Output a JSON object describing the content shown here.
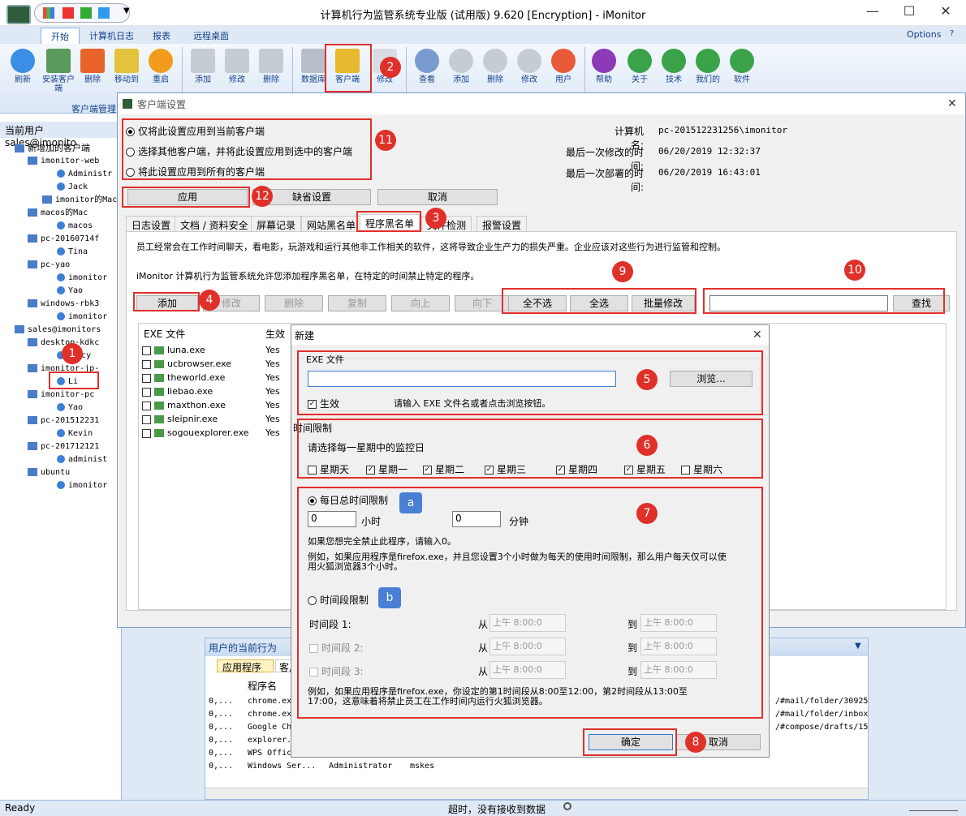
{
  "app": {
    "title": "计算机行为监管系统专业版 (试用版) 9.620 [Encryption] - iMonitor"
  },
  "ribbon": {
    "tabs": [
      "开始",
      "计算机日志",
      "报表",
      "远程桌面"
    ],
    "options": "Options",
    "group_client": "客户端管理",
    "buttons": [
      "刷新",
      "安装客户端",
      "删除",
      "移动到",
      "重启",
      "添加",
      "修改",
      "删除",
      "数据库",
      "客户端",
      "修改",
      "查看",
      "添加",
      "删除",
      "修改",
      "用户",
      "帮助",
      "关于",
      "技术",
      "我们的",
      "软件"
    ]
  },
  "left": {
    "header": "当前用户  sales@imonito",
    "tree": [
      "新增加的客户端",
      "imonitor-web",
      "Administr",
      "Jack",
      "imonitor的Mac",
      "macos的Mac",
      "macos",
      "pc-20160714f",
      "Tina",
      "pc-yao",
      "imonitor",
      "Yao",
      "windows-rbk3",
      "imonitor",
      "sales@imonitors",
      "desktop-kdkc",
      "cy",
      "Nancy",
      "imonitor-jp-",
      "Li",
      "imonitor-pc",
      "Yao",
      "pc-201512231",
      "Kevin",
      "pc-201712121",
      "administ",
      "ubuntu",
      "imonitor"
    ]
  },
  "dialog": {
    "title": "客户端设置",
    "radio1": "仅将此设置应用到当前客户端",
    "radio2": "选择其他客户端，并将此设置应用到选中的客户端",
    "radio3": "将此设置应用到所有的客户端",
    "pc_label": "计算机名:",
    "pc_value": "pc-201512231256\\imonitor",
    "mod_label": "最后一次修改的时间:",
    "mod_value": "06/20/2019 12:32:37",
    "dep_label": "最后一次部署的时间:",
    "dep_value": "06/20/2019 16:43:01",
    "apply": "应用",
    "default": "缺省设置",
    "cancel": "取消",
    "tabs": [
      "日志设置",
      "文档 / 资料安全",
      "屏幕记录",
      "网站黑名单",
      "程序黑名单",
      "文件检测",
      "报警设置"
    ],
    "desc1": "员工经常会在工作时间聊天，看电影，玩游戏和运行其他非工作相关的软件，这将导致企业生产力的损失严重。企业应该对这些行为进行监管和控制。",
    "desc2": "iMonitor 计算机行为监管系统允许您添加程序黑名单，在特定的时间禁止特定的程序。",
    "btns": {
      "add": "添加",
      "modify": "修改",
      "delete": "删除",
      "copy": "复制",
      "up": "向上",
      "down": "向下",
      "unselect": "全不选",
      "selectall": "全选",
      "batch": "批量修改",
      "search": "查找"
    },
    "col_exe": "EXE 文件",
    "col_active": "生效",
    "rows": [
      {
        "exe": "luna.exe",
        "active": "Yes"
      },
      {
        "exe": "ucbrowser.exe",
        "active": "Yes"
      },
      {
        "exe": "theworld.exe",
        "active": "Yes"
      },
      {
        "exe": "liebao.exe",
        "active": "Yes"
      },
      {
        "exe": "maxthon.exe",
        "active": "Yes"
      },
      {
        "exe": "sleipnir.exe",
        "active": "Yes"
      },
      {
        "exe": "sogouexplorer.exe",
        "active": "Yes"
      }
    ]
  },
  "newdlg": {
    "title": "新建",
    "exe_group": "EXE 文件",
    "browse": "浏览...",
    "active": "生效",
    "exe_hint": "请输入 EXE 文件名或者点击浏览按钮。",
    "time_group": "时间限制",
    "days_hint": "请选择每一星期中的监控日",
    "days": [
      {
        "label": "星期天",
        "checked": false
      },
      {
        "label": "星期一",
        "checked": true
      },
      {
        "label": "星期二",
        "checked": true
      },
      {
        "label": "星期三",
        "checked": true
      },
      {
        "label": "星期四",
        "checked": true
      },
      {
        "label": "星期五",
        "checked": true
      },
      {
        "label": "星期六",
        "checked": false
      }
    ],
    "daily": "每日总时间限制",
    "hours_val": "0",
    "hours_unit": "小时",
    "mins_val": "0",
    "mins_unit": "分钟",
    "zero_hint": "如果您想完全禁止此程序，请输入0。",
    "example1": "例如，如果应用程序是firefox.exe，并且您设置3个小时做为每天的使用时间限制，那么用户每天仅可以使用火狐浏览器3个小时。",
    "period": "时间段限制",
    "seg1": "时间段 1:",
    "seg2": "时间段 2:",
    "seg3": "时间段 3:",
    "from": "从",
    "to": "到",
    "am": "上午",
    "time": "8:00:0",
    "example2": "例如，如果应用程序是firefox.exe，你设定的第1时间段从8:00至12:00，第2时间段从13:00至17:00，这意味着将禁止员工在工作时间内运行火狐浏览器。",
    "ok": "确定",
    "cancel": "取消"
  },
  "annotations": {
    "n1": "1",
    "n2": "2",
    "n3": "3",
    "n4": "4",
    "n5": "5",
    "n6": "6",
    "n7": "7",
    "n8": "8",
    "n9": "9",
    "n10": "10",
    "n11": "11",
    "n12": "12",
    "a": "a",
    "b": "b"
  },
  "lower": {
    "title": "用户的当前行为",
    "tab1": "应用程序",
    "tab2": "客户",
    "col": "程序名",
    "rows": [
      {
        "t": "0,...",
        "name": "chrome.exe",
        "url": "/#mail/folder/30925"
      },
      {
        "t": "0,...",
        "name": "chrome.exe",
        "url": "/#mail/folder/inbox"
      },
      {
        "t": "0,...",
        "name": "Google Ch",
        "url": "/#compose/drafts/15"
      },
      {
        "t": "0,...",
        "name": "explorer.",
        "url": ""
      },
      {
        "t": "0,...",
        "name": "WPS Offic",
        "url": ""
      },
      {
        "t": "0,...",
        "name": "Windows Ser...",
        "user": "Administrator",
        "host": "mskes"
      }
    ]
  },
  "status": {
    "ready": "Ready",
    "msg": "超时，没有接收到数据"
  }
}
